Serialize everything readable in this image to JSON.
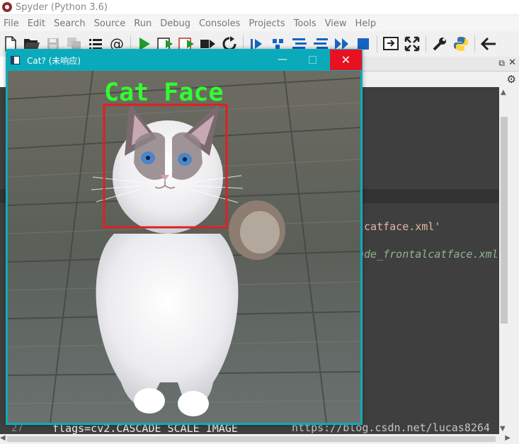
{
  "app": {
    "title": "Spyder (Python 3.6)"
  },
  "menubar": {
    "items": [
      "File",
      "Edit",
      "Search",
      "Source",
      "Run",
      "Debug",
      "Consoles",
      "Projects",
      "Tools",
      "View",
      "Help"
    ]
  },
  "toolbar": {
    "icons": [
      "new-file-icon",
      "open-folder-icon",
      "save-icon",
      "save-all-icon",
      "list-icon",
      "at-icon",
      "run-icon",
      "run-cell-icon",
      "run-cell-advance-icon",
      "run-selection-icon",
      "rerun-icon",
      "debug-icon",
      "step-icon",
      "step-into-icon",
      "step-return-icon",
      "continue-icon",
      "stop-icon",
      "maximize-pane-icon",
      "fullscreen-icon",
      "wrench-icon",
      "python-icon",
      "back-arrow-icon"
    ]
  },
  "editor": {
    "lines": [
      {
        "text": "lcatface.xml'",
        "style": "str"
      },
      {
        "text": "ade_frontalcatface.xml",
        "style": "comment"
      },
      {
        "number": "27",
        "text": "flags=cv2.CASCADE_SCALE_IMAGE",
        "style": "plain"
      }
    ],
    "watermark": "https://blog.csdn.net/lucas8264"
  },
  "cat_window": {
    "title": "Cat? (未响应)",
    "detection_label": "Cat Face",
    "box_color": "#e02020",
    "label_color": "#30ff30"
  },
  "colors": {
    "cat_window_frame": "#0aaaba",
    "close_button": "#e81123",
    "editor_bg": "#3f3f3f"
  }
}
